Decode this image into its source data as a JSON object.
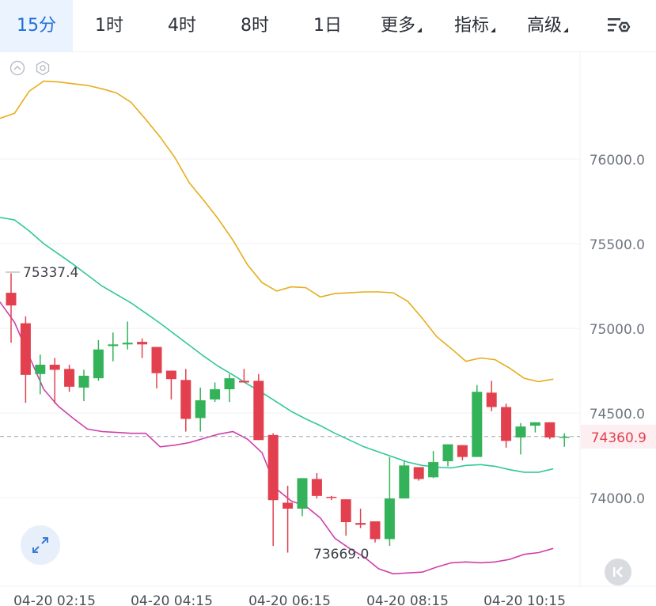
{
  "tabs": [
    {
      "label": "15分",
      "active": true,
      "dropdown": false
    },
    {
      "label": "1时",
      "active": false,
      "dropdown": false
    },
    {
      "label": "4时",
      "active": false,
      "dropdown": false
    },
    {
      "label": "8时",
      "active": false,
      "dropdown": false
    },
    {
      "label": "1日",
      "active": false,
      "dropdown": false
    },
    {
      "label": "更多",
      "active": false,
      "dropdown": true
    },
    {
      "label": "指标",
      "active": false,
      "dropdown": true
    },
    {
      "label": "高级",
      "active": false,
      "dropdown": true
    }
  ],
  "icons": {
    "settings": "chart-settings-icon",
    "collapse": "collapse-up-icon",
    "indicator": "hexagon-settings-icon",
    "expand": "expand-arrows-icon",
    "back": "back-to-start-icon"
  },
  "colors": {
    "accent": "#1e6fd9",
    "up": "#34b25a",
    "down": "#e2404f",
    "band_upper": "#e6ad1c",
    "band_mid": "#31c79a",
    "band_lower": "#cf3fab"
  },
  "chart_data": {
    "type": "candlestick",
    "ylim": [
      73500,
      76600
    ],
    "yticks": [
      "76000.0",
      "75500.0",
      "75000.0",
      "74500.0",
      "74000.0"
    ],
    "xtick_labels": [
      "04-20 02:15",
      "04-20 04:15",
      "04-20 06:15",
      "04-20 08:15",
      "04-20 10:15"
    ],
    "candles": [
      {
        "o": 75210,
        "h": 75325,
        "l": 74915,
        "c": 75135
      },
      {
        "o": 75030,
        "h": 75070,
        "l": 74560,
        "c": 74725
      },
      {
        "o": 74730,
        "h": 74845,
        "l": 74610,
        "c": 74785
      },
      {
        "o": 74785,
        "h": 74825,
        "l": 74555,
        "c": 74755
      },
      {
        "o": 74760,
        "h": 74785,
        "l": 74625,
        "c": 74655
      },
      {
        "o": 74650,
        "h": 74755,
        "l": 74570,
        "c": 74720
      },
      {
        "o": 74705,
        "h": 74930,
        "l": 74690,
        "c": 74875
      },
      {
        "o": 74895,
        "h": 74975,
        "l": 74805,
        "c": 74905
      },
      {
        "o": 74905,
        "h": 75040,
        "l": 74875,
        "c": 74915
      },
      {
        "o": 74920,
        "h": 74940,
        "l": 74825,
        "c": 74905
      },
      {
        "o": 74890,
        "h": 74890,
        "l": 74645,
        "c": 74735
      },
      {
        "o": 74750,
        "h": 74750,
        "l": 74580,
        "c": 74700
      },
      {
        "o": 74695,
        "h": 74760,
        "l": 74390,
        "c": 74465
      },
      {
        "o": 74470,
        "h": 74650,
        "l": 74390,
        "c": 74575
      },
      {
        "o": 74580,
        "h": 74680,
        "l": 74565,
        "c": 74640
      },
      {
        "o": 74640,
        "h": 74730,
        "l": 74565,
        "c": 74705
      },
      {
        "o": 74690,
        "h": 74760,
        "l": 74680,
        "c": 74680
      },
      {
        "o": 74690,
        "h": 74730,
        "l": 74340,
        "c": 74340
      },
      {
        "o": 74370,
        "h": 74380,
        "l": 73715,
        "c": 73985
      },
      {
        "o": 73970,
        "h": 74070,
        "l": 73675,
        "c": 73935
      },
      {
        "o": 73935,
        "h": 74115,
        "l": 73890,
        "c": 74115
      },
      {
        "o": 74110,
        "h": 74145,
        "l": 73995,
        "c": 74010
      },
      {
        "o": 74005,
        "h": 74010,
        "l": 73985,
        "c": 74000
      },
      {
        "o": 73990,
        "h": 73990,
        "l": 73775,
        "c": 73855
      },
      {
        "o": 73850,
        "h": 73935,
        "l": 73820,
        "c": 73840
      },
      {
        "o": 73860,
        "h": 73860,
        "l": 73735,
        "c": 73755
      },
      {
        "o": 73755,
        "h": 74240,
        "l": 73715,
        "c": 73995
      },
      {
        "o": 73995,
        "h": 74215,
        "l": 73995,
        "c": 74190
      },
      {
        "o": 74180,
        "h": 74180,
        "l": 74100,
        "c": 74110
      },
      {
        "o": 74120,
        "h": 74275,
        "l": 74115,
        "c": 74210
      },
      {
        "o": 74215,
        "h": 74315,
        "l": 74185,
        "c": 74315
      },
      {
        "o": 74310,
        "h": 74310,
        "l": 74220,
        "c": 74240
      },
      {
        "o": 74240,
        "h": 74665,
        "l": 74240,
        "c": 74625
      },
      {
        "o": 74620,
        "h": 74690,
        "l": 74510,
        "c": 74535
      },
      {
        "o": 74535,
        "h": 74555,
        "l": 74295,
        "c": 74335
      },
      {
        "o": 74355,
        "h": 74440,
        "l": 74255,
        "c": 74420
      },
      {
        "o": 74425,
        "h": 74445,
        "l": 74385,
        "c": 74445
      },
      {
        "o": 74445,
        "h": 74445,
        "l": 74345,
        "c": 74355
      },
      {
        "o": 74360,
        "h": 74380,
        "l": 74300,
        "c": 74360
      }
    ],
    "upper_band": [
      76240,
      76270,
      76400,
      76460,
      76455,
      76445,
      76435,
      76415,
      76390,
      76335,
      76235,
      76130,
      76010,
      75860,
      75755,
      75645,
      75520,
      75375,
      75270,
      75220,
      75245,
      75240,
      75185,
      75205,
      75210,
      75215,
      75215,
      75210,
      75160,
      75060,
      74950,
      74880,
      74805,
      74825,
      74815,
      74765,
      74705,
      74685,
      74700
    ],
    "mid_band": [
      75655,
      75640,
      75575,
      75500,
      75440,
      75380,
      75315,
      75250,
      75200,
      75150,
      75090,
      75030,
      74965,
      74900,
      74835,
      74775,
      74725,
      74670,
      74620,
      74565,
      74510,
      74465,
      74425,
      74380,
      74340,
      74300,
      74270,
      74240,
      74210,
      74190,
      74180,
      74175,
      74190,
      74195,
      74185,
      74165,
      74150,
      74150,
      74170
    ],
    "lower_band": [
      75155,
      75035,
      74835,
      74640,
      74540,
      74470,
      74405,
      74390,
      74385,
      74380,
      74380,
      74300,
      74310,
      74325,
      74350,
      74375,
      74390,
      74345,
      74265,
      74050,
      73980,
      73950,
      73880,
      73760,
      73700,
      73650,
      73580,
      73550,
      73555,
      73560,
      73590,
      73615,
      73620,
      73615,
      73620,
      73635,
      73665,
      73675,
      73700
    ],
    "annotations": {
      "high": "75337.4",
      "low": "73669.0"
    },
    "last_price": "74360.9",
    "last_value": 74360.9
  }
}
